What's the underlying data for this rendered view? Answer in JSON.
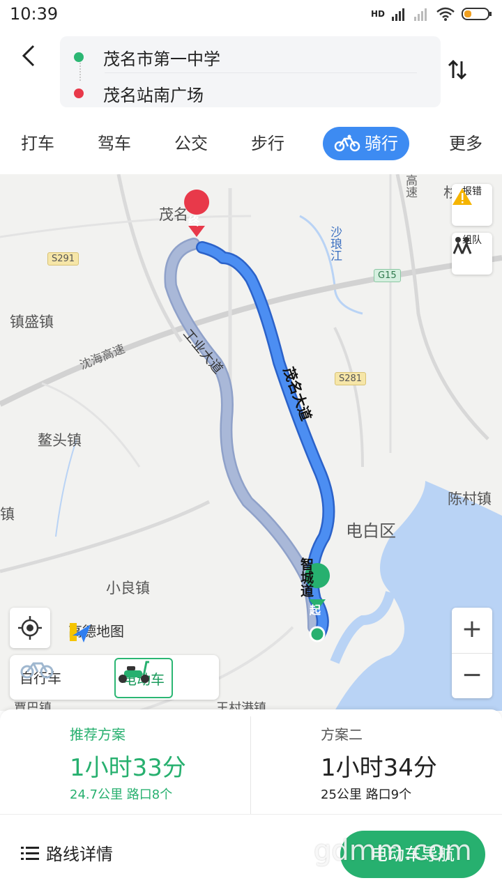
{
  "status_bar": {
    "time": "10:39",
    "network": "HD"
  },
  "route": {
    "origin": "茂名市第一中学",
    "destination": "茂名站南广场"
  },
  "tabs": [
    {
      "label": "打车"
    },
    {
      "label": "驾车"
    },
    {
      "label": "公交"
    },
    {
      "label": "步行"
    },
    {
      "label": "骑行",
      "active": true
    },
    {
      "label": "更多"
    }
  ],
  "map": {
    "labels": [
      "茂名",
      "镇盛镇",
      "鳌头镇",
      "镇",
      "小良镇",
      "电白区",
      "陈村镇",
      "沙琅江",
      "高速",
      "杉",
      "覃巴镇",
      "王村港镇"
    ],
    "road_labels": [
      "沈海高速",
      "工业大道",
      "茂名大道",
      "智城道"
    ],
    "shields": [
      "S291",
      "G15",
      "S281"
    ],
    "end_marker": "终",
    "start_marker": "起",
    "report_label": "报错",
    "team_label": "组队",
    "logo_text": "高德地图",
    "zoom_in": "+",
    "zoom_out": "−"
  },
  "vehicle": {
    "bicycle": "自行车",
    "ebike": "电动车"
  },
  "plans": [
    {
      "label": "推荐方案",
      "duration": "1小时33分",
      "meta": "24.7公里 路口8个"
    },
    {
      "label": "方案二",
      "duration": "1小时34分",
      "meta": "25公里 路口9个"
    }
  ],
  "footer": {
    "details": "路线详情",
    "navigate": "电动车导航",
    "watermark": "gdmm.com"
  },
  "colors": {
    "accent_blue": "#3d8bf2",
    "accent_green": "#27b06f",
    "route_alt": "#a9b8d8",
    "end_red": "#e8394a"
  }
}
